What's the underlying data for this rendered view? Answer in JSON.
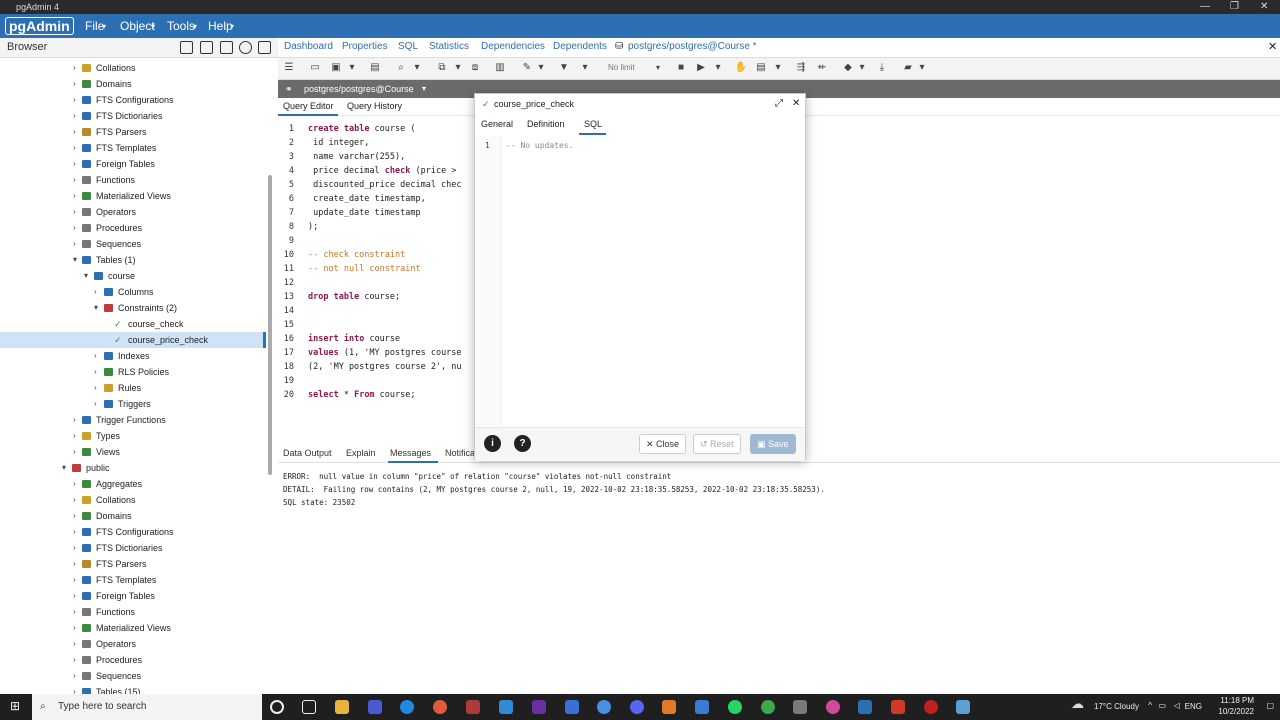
{
  "window": {
    "title": "pgAdmin 4"
  },
  "menubar": {
    "logo": "pgAdmin",
    "items": [
      "File",
      "Object",
      "Tools",
      "Help"
    ]
  },
  "browser": {
    "label": "Browser",
    "tree": [
      {
        "label": "Collations"
      },
      {
        "label": "Domains"
      },
      {
        "label": "FTS Configurations"
      },
      {
        "label": "FTS Dictionaries"
      },
      {
        "label": "FTS Parsers"
      },
      {
        "label": "FTS Templates"
      },
      {
        "label": "Foreign Tables"
      },
      {
        "label": "Functions"
      },
      {
        "label": "Materialized Views"
      },
      {
        "label": "Operators"
      },
      {
        "label": "Procedures"
      },
      {
        "label": "Sequences"
      },
      {
        "label": "Tables (1)"
      },
      {
        "label": "course"
      },
      {
        "label": "Columns"
      },
      {
        "label": "Constraints (2)"
      },
      {
        "label": "course_check"
      },
      {
        "label": "course_price_check"
      },
      {
        "label": "Indexes"
      },
      {
        "label": "RLS Policies"
      },
      {
        "label": "Rules"
      },
      {
        "label": "Triggers"
      },
      {
        "label": "Trigger Functions"
      },
      {
        "label": "Types"
      },
      {
        "label": "Views"
      },
      {
        "label": "public"
      },
      {
        "label": "Aggregates"
      },
      {
        "label": "Collations"
      },
      {
        "label": "Domains"
      },
      {
        "label": "FTS Configurations"
      },
      {
        "label": "FTS Dictionaries"
      },
      {
        "label": "FTS Parsers"
      },
      {
        "label": "FTS Templates"
      },
      {
        "label": "Foreign Tables"
      },
      {
        "label": "Functions"
      },
      {
        "label": "Materialized Views"
      },
      {
        "label": "Operators"
      },
      {
        "label": "Procedures"
      },
      {
        "label": "Sequences"
      },
      {
        "label": "Tables (15)"
      }
    ]
  },
  "tabs": {
    "items": [
      "Dashboard",
      "Properties",
      "SQL",
      "Statistics",
      "Dependencies",
      "Dependents"
    ],
    "active": "postgres/postgres@Course *"
  },
  "query_toolbar": {
    "limit": "No limit"
  },
  "connection": {
    "label": "postgres/postgres@Course"
  },
  "editor_tabs": {
    "query_editor": "Query Editor",
    "query_history": "Query History"
  },
  "editor": {
    "line_numbers": [
      "1",
      "2",
      "3",
      "4",
      "5",
      "6",
      "7",
      "8",
      "9",
      "10",
      "11",
      "12",
      "13",
      "14",
      "15",
      "16",
      "17",
      "18",
      "19",
      "20"
    ],
    "lines": [
      "create table course (",
      " id integer,",
      " name varchar(255),",
      " price decimal check (price >",
      " discounted_price decimal chec",
      " create_date timestamp,",
      " update_date timestamp",
      ");",
      "",
      "-- check constraint",
      "-- not null constraint",
      "",
      "drop table course;",
      "",
      "",
      "insert into course",
      "values (1, 'MY postgres course",
      "(2, 'MY postgres course 2', nu",
      "",
      "select * From course;"
    ]
  },
  "output": {
    "tabs": [
      "Data Output",
      "Explain",
      "Messages",
      "Notifications"
    ],
    "messages": [
      "ERROR:  null value in column \"price\" of relation \"course\" violates not-null constraint",
      "DETAIL:  Failing row contains (2, MY postgres course 2, null, 19, 2022-10-02 23:18:35.58253, 2022-10-02 23:18:35.58253).",
      "SQL state: 23502"
    ]
  },
  "dialog": {
    "title": "course_price_check",
    "tabs": [
      "General",
      "Definition",
      "SQL"
    ],
    "active_tab": "SQL",
    "sql_line_number": "1",
    "sql_text": "-- No updates.",
    "buttons": {
      "close": "Close",
      "reset": "Reset",
      "save": "Save"
    }
  },
  "taskbar": {
    "search_placeholder": "Type here to search",
    "weather": "17°C  Cloudy",
    "language": "ENG",
    "time": "11:18 PM",
    "date": "10/2/2022"
  },
  "colors": {
    "accent": "#2d6fb3",
    "selected_row": "#cfe3f7",
    "keyword": "#8b1a4a",
    "comment": "#c5762a"
  }
}
